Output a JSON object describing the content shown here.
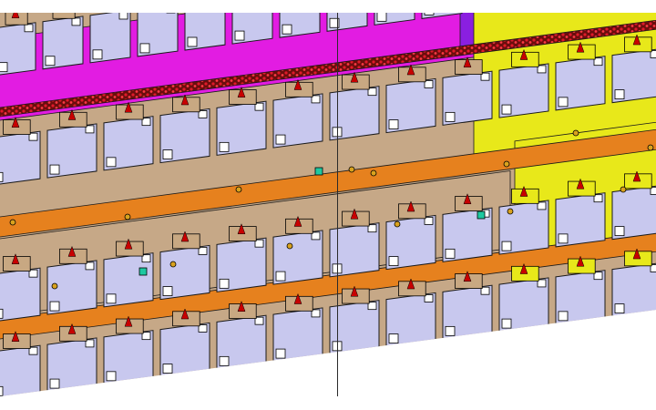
{
  "canvas": {
    "background": "#ffffff",
    "view": "cad-assembly-viewport"
  },
  "colors": {
    "magenta_band": "#e21ce2",
    "purple_band": "#8a1fe0",
    "yellow_band": "#e8e81a",
    "tan_plate": "#c6a887",
    "orange_rail": "#e6811e",
    "red_dots": "#c8102e",
    "cell_fill": "#c8c8ee",
    "cell_outline": "#1a1a1a",
    "clip_tan": "#c8a882",
    "clip_yellow": "#e8e81a",
    "tab_white": "#ffffff",
    "tab_red": "#c80000",
    "marker_teal": "#1ec8a0",
    "bolt_gold": "#d9a21e"
  },
  "slot_rows": [
    {
      "name": "row-top-magenta",
      "slots": 14
    },
    {
      "name": "row-upper-middle",
      "slots": 12
    },
    {
      "name": "row-middle",
      "slots": 12
    },
    {
      "name": "row-lower",
      "slots": 12
    }
  ],
  "markers": [
    {
      "type": "teal",
      "color": "#1ec8a0"
    },
    {
      "type": "teal",
      "color": "#1ec8a0"
    },
    {
      "type": "teal",
      "color": "#1ec8a0"
    }
  ]
}
